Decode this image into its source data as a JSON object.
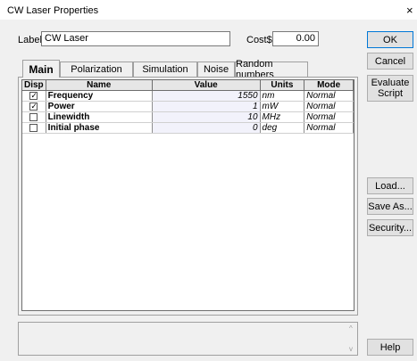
{
  "window": {
    "title": "CW Laser Properties",
    "close_glyph": "×"
  },
  "form": {
    "label_caption": "Label:",
    "label_value": "CW Laser",
    "cost_caption": "Cost$:",
    "cost_value": "0.00"
  },
  "tabs": [
    {
      "label": "Main",
      "active": true
    },
    {
      "label": "Polarization"
    },
    {
      "label": "Simulation"
    },
    {
      "label": "Noise"
    },
    {
      "label": "Random numbers"
    }
  ],
  "table": {
    "columns": [
      "Disp",
      "Name",
      "Value",
      "Units",
      "Mode"
    ],
    "rows": [
      {
        "disp": true,
        "name": "Frequency",
        "value": "1550",
        "units": "nm",
        "mode": "Normal"
      },
      {
        "disp": true,
        "name": "Power",
        "value": "1",
        "units": "mW",
        "mode": "Normal"
      },
      {
        "disp": false,
        "name": "Linewidth",
        "value": "10",
        "units": "MHz",
        "mode": "Normal"
      },
      {
        "disp": false,
        "name": "Initial phase",
        "value": "0",
        "units": "deg",
        "mode": "Normal"
      }
    ]
  },
  "buttons": {
    "ok": "OK",
    "cancel": "Cancel",
    "evaluate_l1": "Evaluate",
    "evaluate_l2": "Script",
    "load": "Load...",
    "save_as": "Save As...",
    "security": "Security...",
    "help": "Help"
  },
  "icons": {
    "scroll_up": "^",
    "scroll_down": "v"
  },
  "colors": {
    "value_cell_bg": "#f2f2fb",
    "ok_border": "#0078d7"
  }
}
